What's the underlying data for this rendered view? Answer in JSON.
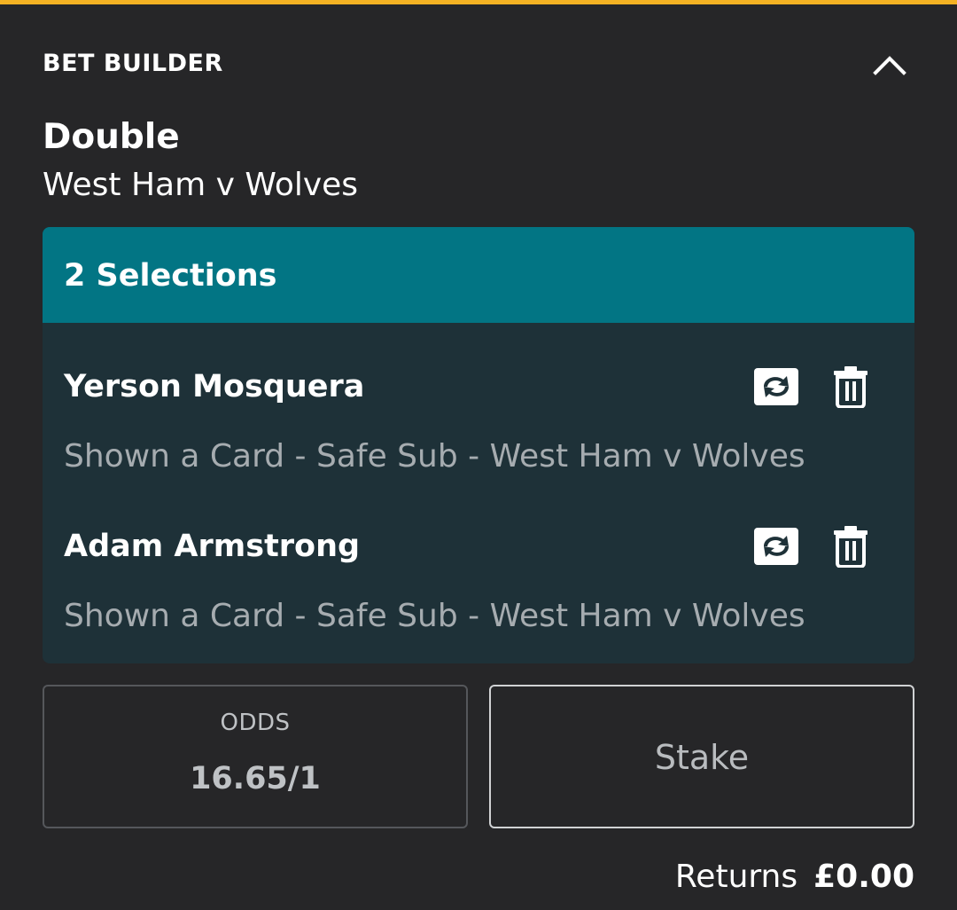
{
  "header": {
    "title": "BET BUILDER",
    "collapse_icon": "chevron-up-icon"
  },
  "bet": {
    "type": "Double",
    "event": "West Ham v Wolves"
  },
  "selections": {
    "title": "2 Selections",
    "items": [
      {
        "name": "Yerson Mosquera",
        "market": "Shown a Card - Safe Sub - West Ham v Wolves",
        "swap_icon": "swap-icon",
        "delete_icon": "trash-icon"
      },
      {
        "name": "Adam Armstrong",
        "market": "Shown a Card - Safe Sub - West Ham v Wolves",
        "swap_icon": "swap-icon",
        "delete_icon": "trash-icon"
      }
    ]
  },
  "odds": {
    "label": "ODDS",
    "value": "16.65/1"
  },
  "stake": {
    "placeholder": "Stake"
  },
  "returns": {
    "label": "Returns",
    "value": "£0.00"
  },
  "colors": {
    "accent": "#f4b223",
    "background": "#262628",
    "selections_header": "#027584",
    "selections_body": "#1e3138"
  }
}
